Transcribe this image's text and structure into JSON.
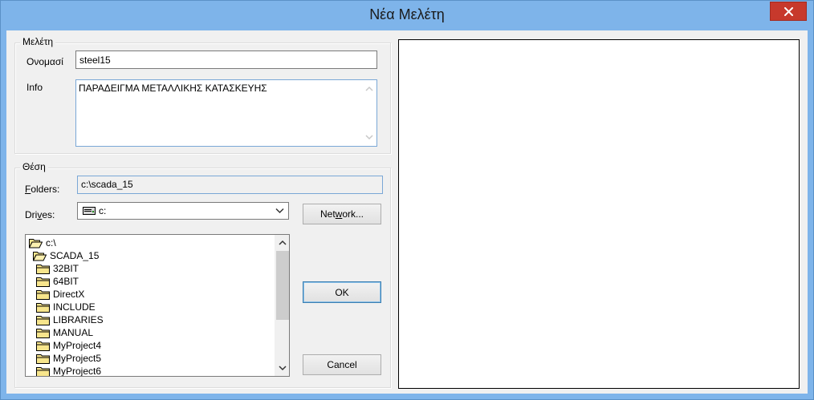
{
  "window": {
    "title": "Νέα Μελέτη"
  },
  "study_group": {
    "title": "Μελέτη",
    "name_label": "Ονομασί",
    "name_value": "steel15",
    "info_label": "Info",
    "info_value": "ΠΑΡΑΔΕΙΓΜΑ ΜΕΤΑΛΛΙΚΗΣ ΚΑΤΑΣΚΕΥΗΣ"
  },
  "location_group": {
    "title": "Θέση",
    "folders_label_key": "F",
    "folders_label_rest": "olders:",
    "folders_value": "c:\\scada_15",
    "drives_label_pre": "Dri",
    "drives_label_key": "v",
    "drives_label_post": "es:",
    "drives_value": "c:",
    "network_pre": "Net",
    "network_key": "w",
    "network_post": "ork...",
    "folders": [
      "c:\\",
      "SCADA_15",
      "32BIT",
      "64BIT",
      "DirectX",
      "INCLUDE",
      "LIBRARIES",
      "MANUAL",
      "MyProject4",
      "MyProject5",
      "MyProject6"
    ]
  },
  "buttons": {
    "ok": "OK",
    "cancel": "Cancel"
  },
  "icons": {
    "close": "close-icon",
    "folder_open": "folder-open-icon",
    "folder": "folder-icon",
    "drive": "drive-icon"
  },
  "colors": {
    "titlebar": "#7eb4ea",
    "close_button": "#c7392c",
    "face": "#f0f0f0",
    "focus_border": "#7aa7d6"
  }
}
